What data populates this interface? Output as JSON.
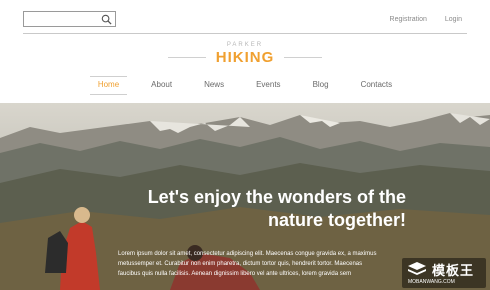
{
  "search": {
    "value": "",
    "placeholder": ""
  },
  "top_links": {
    "registration": "Registration",
    "login": "Login"
  },
  "logo": {
    "small": "PARKER",
    "main": "HIKING"
  },
  "nav": {
    "items": [
      {
        "label": "Home",
        "active": true
      },
      {
        "label": "About",
        "active": false
      },
      {
        "label": "News",
        "active": false
      },
      {
        "label": "Events",
        "active": false
      },
      {
        "label": "Blog",
        "active": false
      },
      {
        "label": "Contacts",
        "active": false
      }
    ]
  },
  "hero": {
    "headline_line1": "Let's enjoy the wonders of the",
    "headline_line2": "nature together!",
    "para_line1": "Lorem ipsum dolor sit amet, consectetur adipiscing elit. Maecenas congue gravida ex, a maximus",
    "para_line2": "metussemper et. Curabitur non enim pharetra, dictum tortor quis, hendrerit tortor. Maecenas",
    "para_line3": "faucibus quis nulla facilisis. Aenean dignissim libero vel ante ultrices, lorem gravida sem"
  },
  "watermark": {
    "cn": "模板王",
    "url": "MOBANWANG.COM"
  },
  "colors": {
    "accent": "#f0a030",
    "hero_text": "#ffffff"
  }
}
